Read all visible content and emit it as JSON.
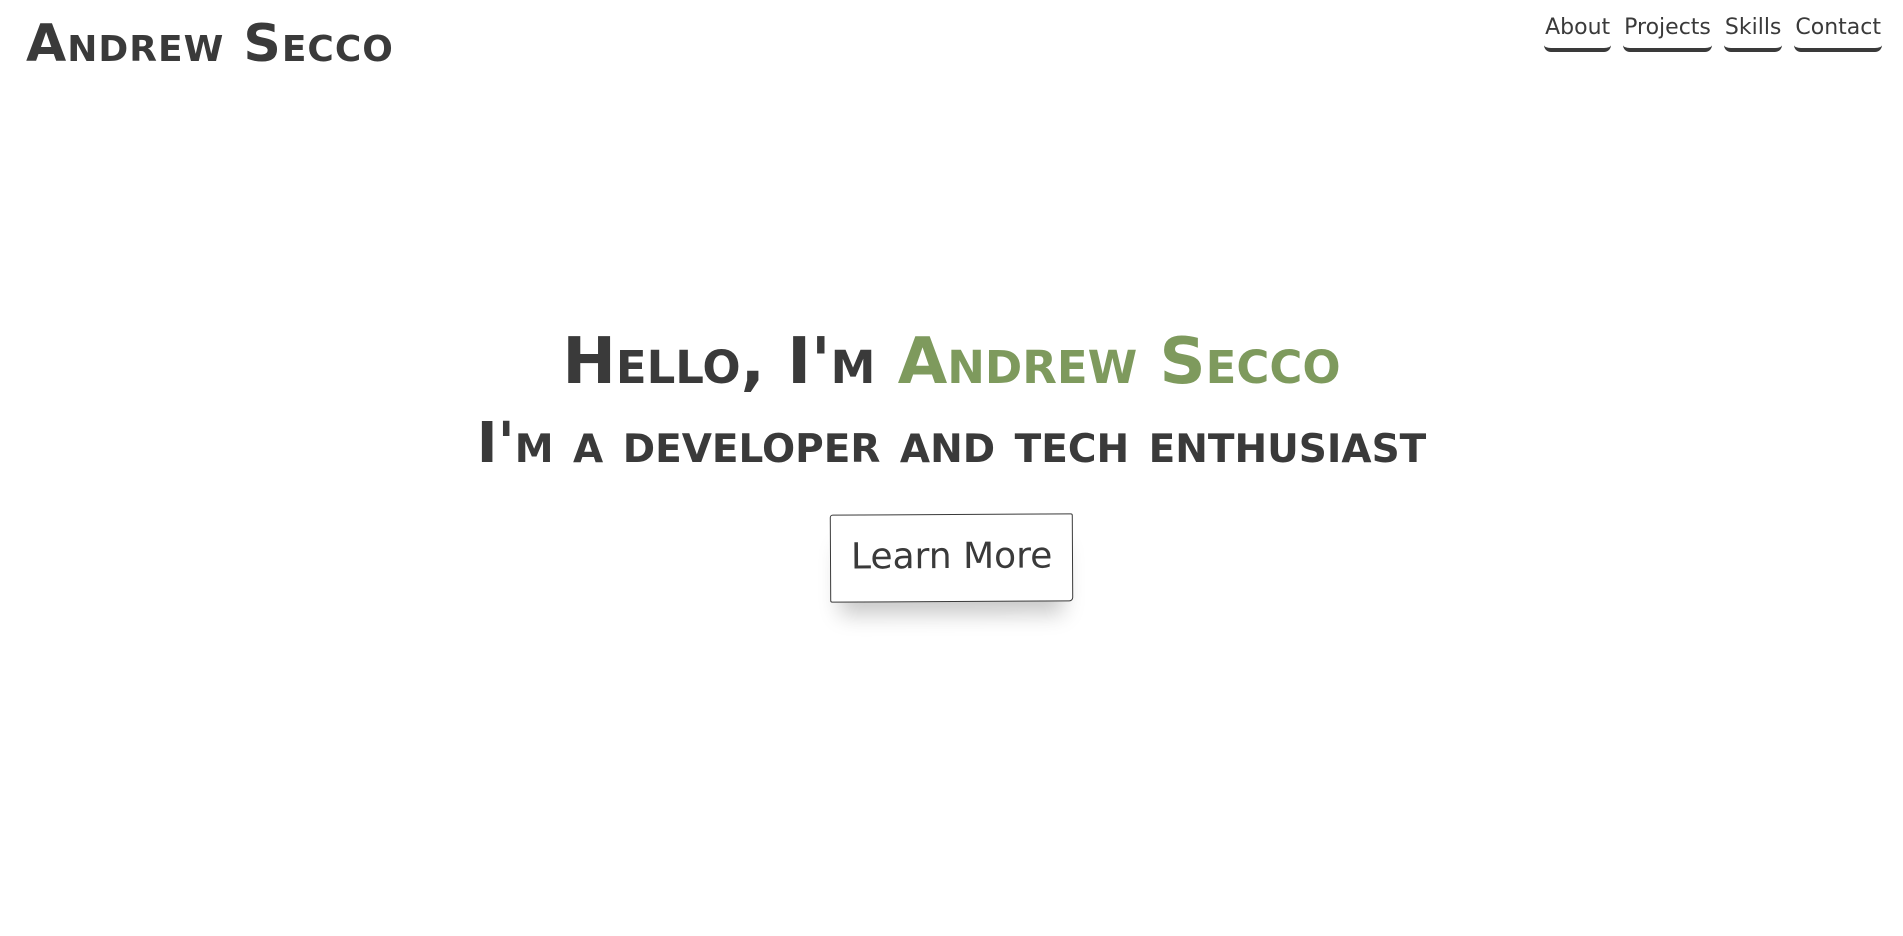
{
  "header": {
    "logo": "Andrew Secco",
    "nav": [
      {
        "label": "About"
      },
      {
        "label": "Projects"
      },
      {
        "label": "Skills"
      },
      {
        "label": "Contact"
      }
    ]
  },
  "hero": {
    "greeting": "Hello, I'm ",
    "name": "Andrew Secco",
    "tagline": "I'm a developer and tech enthusiast",
    "cta_label": "Learn More"
  },
  "colors": {
    "text": "#3a3a3a",
    "accent": "#7e9a5d",
    "background": "#ffffff"
  }
}
